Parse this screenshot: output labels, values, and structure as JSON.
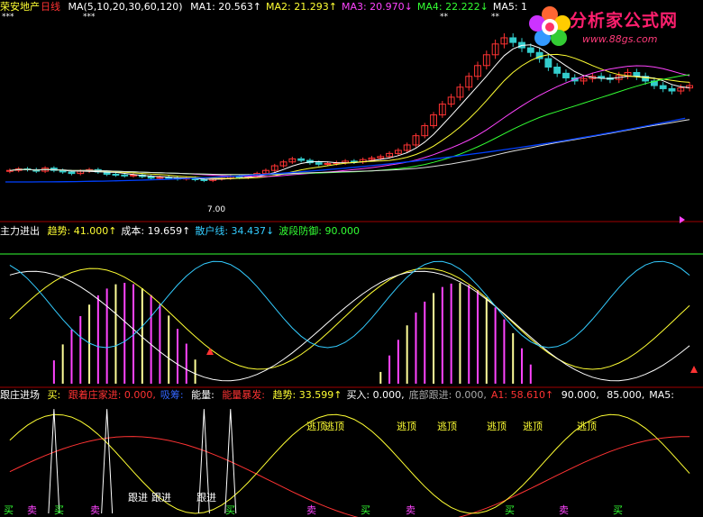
{
  "stock": {
    "name": "荣安地产",
    "period": "日线",
    "ma_spec": "MA(5,10,20,30,60,120)",
    "ma": [
      {
        "label": "MA1:",
        "value": "20.563",
        "arrow": "↑",
        "color": "#ffffff"
      },
      {
        "label": "MA2:",
        "value": "21.293",
        "arrow": "↑",
        "color": "#ffff33"
      },
      {
        "label": "MA3:",
        "value": "20.970",
        "arrow": "↓",
        "color": "#ff44ff"
      },
      {
        "label": "MA4:",
        "value": "22.222",
        "arrow": "↓",
        "color": "#33ff33"
      },
      {
        "label": "MA5:",
        "value": "1",
        "arrow": "",
        "color": "#ffffff"
      }
    ],
    "low_marker": "7.00",
    "stars": [
      "***",
      "***",
      "**",
      "**"
    ]
  },
  "logo": {
    "title": "分析家公式网",
    "url": "www.88gs.com"
  },
  "pane2": {
    "title": "主力进出",
    "items": [
      {
        "label": "趋势:",
        "value": "41.000",
        "arrow": "↑",
        "color": "#ffff33"
      },
      {
        "label": "成本:",
        "value": "19.659",
        "arrow": "↑",
        "color": "#ffffff"
      },
      {
        "label": "散户线:",
        "value": "34.437",
        "arrow": "↓",
        "color": "#33ccff"
      },
      {
        "label": "波段防御:",
        "value": "90.000",
        "arrow": "",
        "color": "#33ff33"
      }
    ]
  },
  "pane3": {
    "title": "跟庄进场",
    "items": [
      {
        "label": "买:",
        "value": "",
        "color": "#ffff33"
      },
      {
        "label": "跟着庄家进:",
        "value": "0.000,",
        "color": "#ff3333"
      },
      {
        "label": "吸筹:",
        "value": "",
        "color": "#3366ff"
      },
      {
        "label": "能量:",
        "value": "",
        "color": "#ffffff"
      },
      {
        "label": "能量暴发:",
        "value": "",
        "color": "#ff3333"
      },
      {
        "label": "趋势:",
        "value": "33.599↑",
        "color": "#ffff33"
      },
      {
        "label": "买入:",
        "value": "0.000,",
        "color": "#ffffff"
      },
      {
        "label": "底部跟进:",
        "value": "0.000,",
        "color": "#aaaaaa"
      },
      {
        "label": "A1:",
        "value": "58.610↑",
        "color": "#ff3333"
      },
      {
        "label": "",
        "value": "90.000,",
        "color": "#ffffff"
      },
      {
        "label": "",
        "value": "85.000,",
        "color": "#ffffff"
      },
      {
        "label": "MA5:",
        "value": "",
        "color": "#ffffff"
      }
    ],
    "escape_label": "逃顶",
    "follow_label": "跟进",
    "buy_label": "买",
    "sell_label": "卖"
  },
  "colors": {
    "candle_up": "#ff3333",
    "candle_down": "#33cccc",
    "ma1": "#ffffff",
    "ma2": "#ffff33",
    "ma3": "#ff44ff",
    "ma4": "#33ff33",
    "ma5": "#0040ff",
    "pane2_cost": "#ffffff",
    "pane2_trend": "#ffff33",
    "pane2_retail": "#33ccff",
    "pane2_guard": "#33ff33",
    "pane2_bars": "#ff44ff",
    "pane3_red": "#ff3333",
    "pane3_yellow": "#ffff33",
    "pane3_white": "#ffffff"
  },
  "chart_data": {
    "type": "line",
    "price_series": {
      "close": [
        12.0,
        12.2,
        12.1,
        11.9,
        12.3,
        12.0,
        11.8,
        11.6,
        11.9,
        12.1,
        11.8,
        11.5,
        11.4,
        11.3,
        11.4,
        11.2,
        11.0,
        11.1,
        11.0,
        10.9,
        11.0,
        10.8,
        10.7,
        10.9,
        11.0,
        11.2,
        11.1,
        11.3,
        11.6,
        12.0,
        12.6,
        13.1,
        13.5,
        13.3,
        13.0,
        12.8,
        12.9,
        13.0,
        13.2,
        13.1,
        13.4,
        13.6,
        13.8,
        14.2,
        14.6,
        15.3,
        16.5,
        17.8,
        19.2,
        20.6,
        21.5,
        22.8,
        24.2,
        25.6,
        27.0,
        28.4,
        29.2,
        28.6,
        27.9,
        27.3,
        26.5,
        25.4,
        24.6,
        24.0,
        23.6,
        23.9,
        24.2,
        24.0,
        23.8,
        24.3,
        24.7,
        24.2,
        23.6,
        23.0,
        22.6,
        22.3,
        22.7,
        23.0
      ]
    },
    "indicator_zero": 0,
    "pane2_guard_level": "90.000"
  }
}
